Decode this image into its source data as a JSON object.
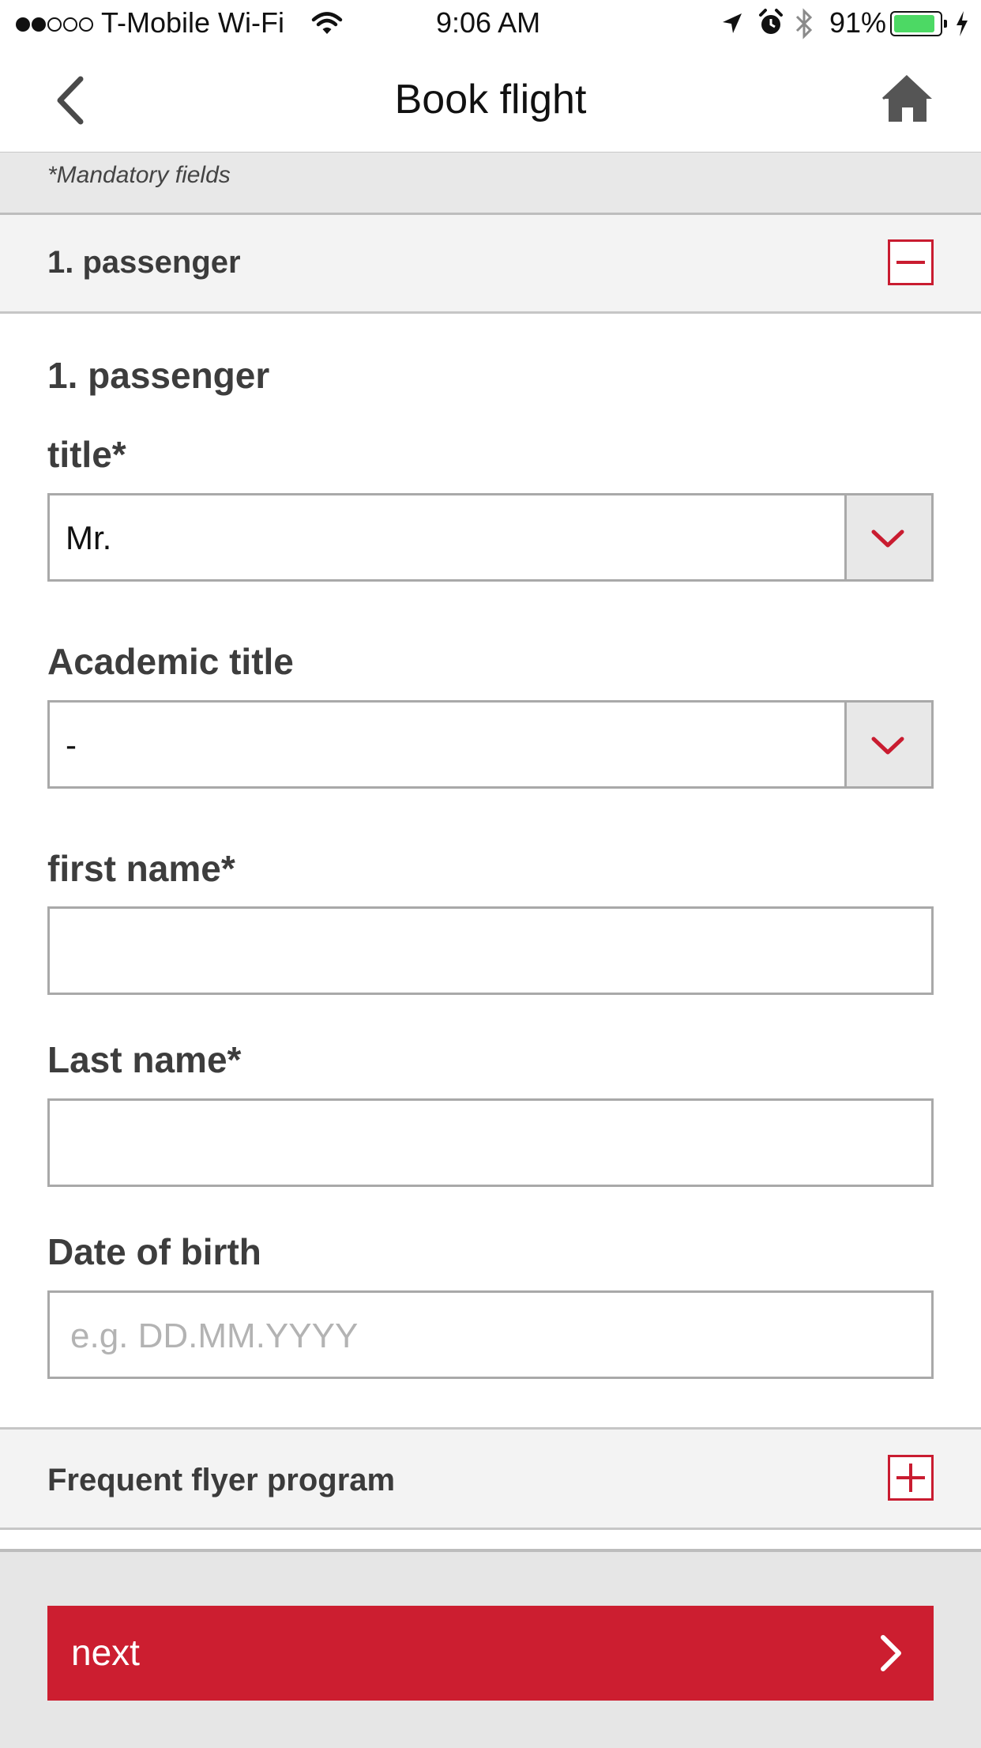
{
  "status_bar": {
    "carrier": "T-Mobile Wi-Fi",
    "time": "9:06 AM",
    "battery": "91%",
    "signal_bars_filled": 2,
    "signal_bars_total": 5,
    "battery_level": 0.91
  },
  "nav": {
    "title": "Book flight",
    "back_icon": "chevron-left-icon",
    "home_icon": "home-icon"
  },
  "form": {
    "mandatory_note": "*Mandatory fields",
    "section_header": "1. passenger",
    "section_title": "1. passenger",
    "title_label": "title*",
    "title_value": "Mr.",
    "academic_label": "Academic title",
    "academic_value": "-",
    "first_name_label": "first name*",
    "first_name_value": "",
    "last_name_label": "Last name*",
    "last_name_value": "",
    "dob_label": "Date of birth",
    "dob_placeholder": "e.g. DD.MM.YYYY",
    "ffp_header": "Frequent flyer program"
  },
  "footer": {
    "next_label": "next"
  },
  "colors": {
    "accent": "#cc1e30",
    "battery_green": "#4cd964"
  }
}
